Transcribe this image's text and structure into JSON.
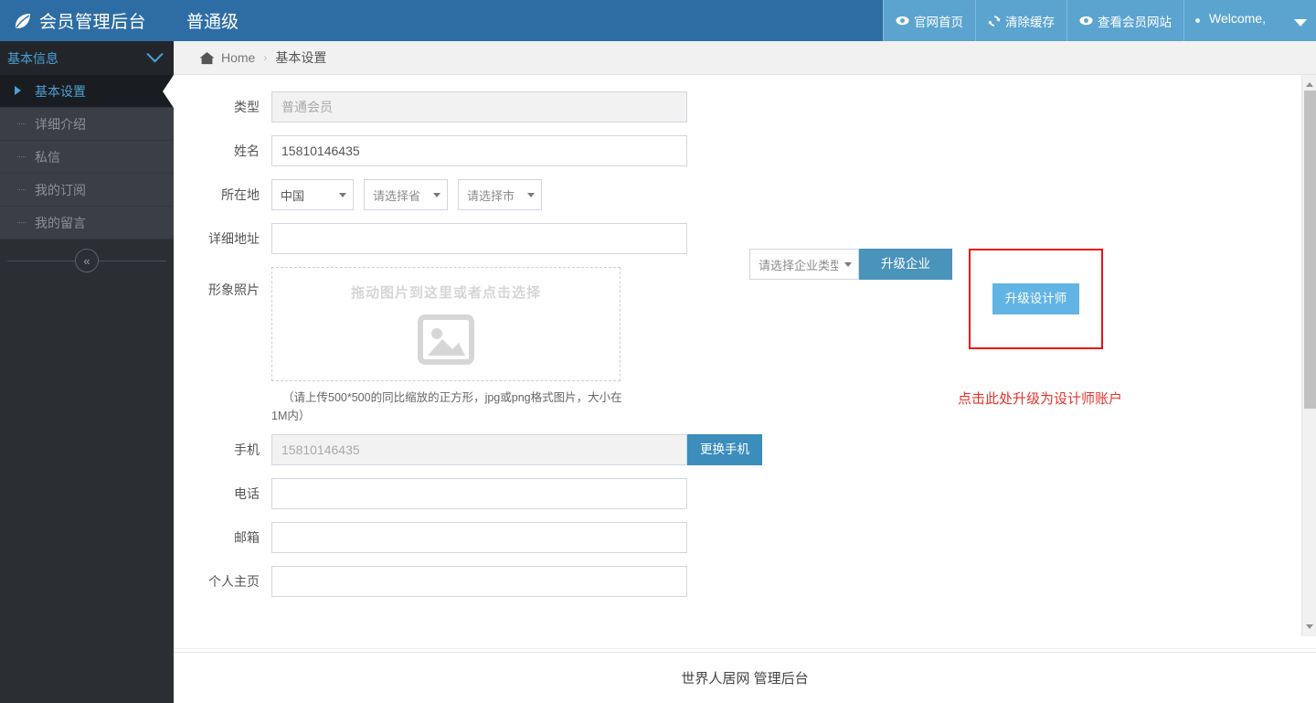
{
  "navbar": {
    "logo_icon": "leaf-icon",
    "brand": "会员管理后台",
    "level": "普通级",
    "items": [
      {
        "icon": "eye-icon",
        "label": "官网首页"
      },
      {
        "icon": "refresh-icon",
        "label": "清除缓存"
      },
      {
        "icon": "eye-icon",
        "label": "查看会员网站"
      }
    ],
    "user": {
      "greeting": "Welcome,",
      "caret_icon": "caret-down-icon"
    }
  },
  "sidebar": {
    "group_title": "基本信息",
    "group_chevron_icon": "chevron-down-icon",
    "items": [
      {
        "label": "基本设置",
        "active": true
      },
      {
        "label": "详细介绍",
        "active": false
      },
      {
        "label": "私信",
        "active": false
      },
      {
        "label": "我的订阅",
        "active": false
      },
      {
        "label": "我的留言",
        "active": false
      }
    ],
    "collapse_icon": "«"
  },
  "breadcrumb": {
    "home_icon": "home-icon",
    "home": "Home",
    "separator": "›",
    "current": "基本设置"
  },
  "form": {
    "type": {
      "label": "类型",
      "value": "普通会员",
      "disabled": true
    },
    "name": {
      "label": "姓名",
      "value": "15810146435",
      "placeholder": ""
    },
    "location": {
      "label": "所在地",
      "country": "中国",
      "province": "请选择省",
      "city": "请选择市"
    },
    "address": {
      "label": "详细地址",
      "value": "",
      "placeholder": ""
    },
    "photo": {
      "label": "形象照片",
      "dropzone_text": "拖动图片到这里或者点击选择",
      "image_icon": "image-placeholder-icon",
      "hint": "（请上传500*500的同比缩放的正方形，jpg或png格式图片，大小在1M内）"
    },
    "mobile": {
      "label": "手机",
      "value": "15810146435",
      "button": "更换手机",
      "disabled": true
    },
    "telephone": {
      "label": "电话",
      "value": "",
      "placeholder": ""
    },
    "email": {
      "label": "邮箱",
      "value": "",
      "placeholder": ""
    },
    "homepage": {
      "label": "个人主页",
      "value": "",
      "placeholder": ""
    }
  },
  "upgrade": {
    "biztype_select": "请选择企业类型",
    "enterprise_button": "升级企业",
    "designer_button": "升级设计师",
    "annotation": "点击此处升级为设计师账户",
    "annotation_color": "#e8332a",
    "highlight_border_color": "#ee1111"
  },
  "footer": {
    "text": "世界人居网 管理后台"
  },
  "colors": {
    "navbar_light": "#5ba4cf",
    "navbar_dark": "#2e6da4",
    "sidebar_bg": "#2b2f34",
    "sidebar_item_bg": "#3a3f45",
    "sidebar_active_bg": "#191c20",
    "accent_blue": "#4d9fd4",
    "button_enterprise": "#4a93bb",
    "button_designer": "#62b4e5",
    "button_phone": "#3c8dbc"
  }
}
